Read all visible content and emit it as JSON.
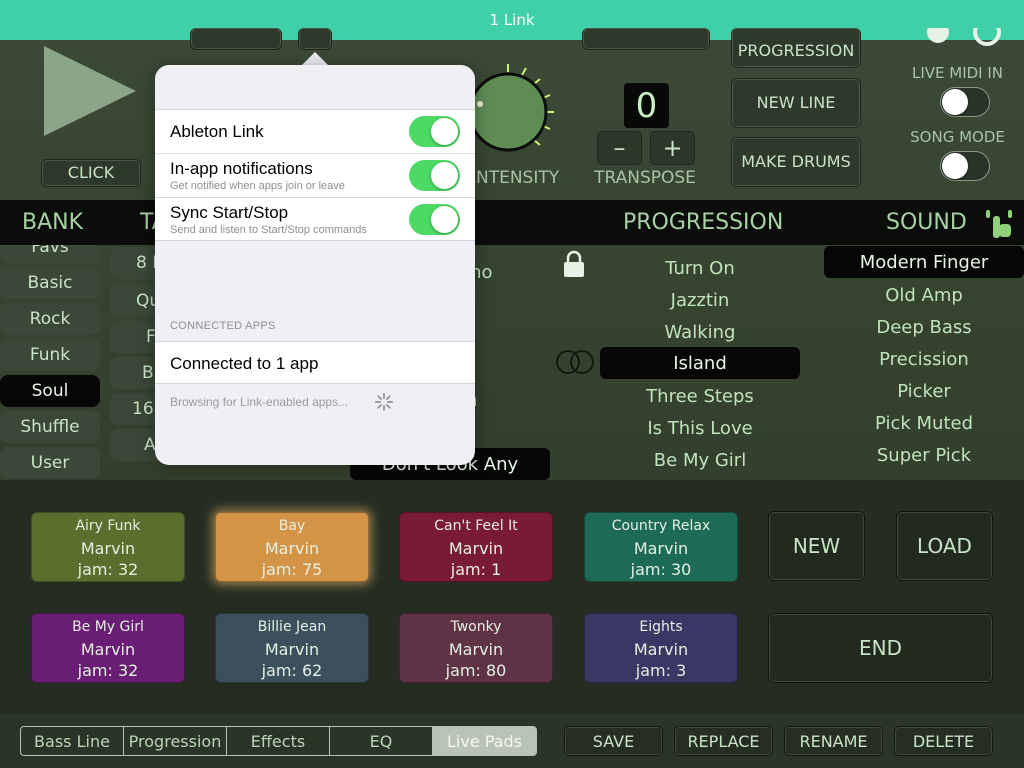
{
  "topbar": {
    "title": "1 Link"
  },
  "controls": {
    "click_label": "CLICK",
    "intensity_label": "M INTENSITY",
    "transpose_value": "0",
    "transpose_label": "TRANSPOSE",
    "minus": "–",
    "plus": "+",
    "new_progression": "PROGRESSION",
    "new_line": "NEW LINE",
    "make_drums": "MAKE DRUMS",
    "live_midi_in": "LIVE MIDI IN",
    "song_mode": "SONG MODE"
  },
  "headers": {
    "bank": "BANK",
    "tab": "TA",
    "progression": "PROGRESSION",
    "sound": "SOUND"
  },
  "bank": {
    "items": [
      "Favs",
      "Basic",
      "Rock",
      "Funk",
      "Soul",
      "Shuffle",
      "User"
    ],
    "selected": "Soul"
  },
  "col2": {
    "items": [
      "8 F",
      "Qu",
      "F",
      "Bu",
      "16",
      "A"
    ]
  },
  "progression": {
    "items": [
      "Turn On",
      "Jazztin",
      "Walking",
      "Island",
      "Three Steps",
      "Is This Love",
      "Be My Girl"
    ],
    "selected": "Island"
  },
  "sound": {
    "items": [
      "Modern Finger",
      "Old Amp",
      "Deep Bass",
      "Precission",
      "Picker",
      "Pick Muted",
      "Super Pick"
    ],
    "selected": "Modern Finger"
  },
  "midlist": {
    "partial1": "rno",
    "partial2": "n",
    "selected": "Don't Look Any"
  },
  "pads": [
    {
      "name": "Airy Funk",
      "artist": "Marvin",
      "jam": "jam: 32",
      "color": "#5a6e2e"
    },
    {
      "name": "Bay",
      "artist": "Marvin",
      "jam": "jam: 75",
      "color": "#d49448"
    },
    {
      "name": "Can't Feel It",
      "artist": "Marvin",
      "jam": "jam: 1",
      "color": "#7a1b35"
    },
    {
      "name": "Country Relax",
      "artist": "Marvin",
      "jam": "jam: 30",
      "color": "#1d6b57"
    },
    {
      "name": "Be My Girl",
      "artist": "Marvin",
      "jam": "jam: 32",
      "color": "#6a1d74"
    },
    {
      "name": "Billie Jean",
      "artist": "Marvin",
      "jam": "jam: 62",
      "color": "#3c4f5c"
    },
    {
      "name": "Twonky",
      "artist": "Marvin",
      "jam": "jam: 80",
      "color": "#5f3345"
    },
    {
      "name": "Eights",
      "artist": "Marvin",
      "jam": "jam: 3",
      "color": "#3b3765"
    }
  ],
  "pad_buttons": {
    "new": "NEW",
    "load": "LOAD",
    "end": "END"
  },
  "footer": {
    "tabs": [
      "Bass Line",
      "Progression",
      "Effects",
      "EQ",
      "Live Pads"
    ],
    "selected_tab": "Live Pads",
    "save": "SAVE",
    "replace": "REPLACE",
    "rename": "RENAME",
    "delete": "DELETE"
  },
  "link_popover": {
    "ableton_link": "Ableton Link",
    "notifications_title": "In-app notifications",
    "notifications_sub": "Get notified when apps join or leave",
    "sync_title": "Sync Start/Stop",
    "sync_sub": "Send and listen to Start/Stop commands",
    "section_header": "CONNECTED APPS",
    "connected": "Connected to 1 app",
    "browsing": "Browsing for Link-enabled apps..."
  }
}
